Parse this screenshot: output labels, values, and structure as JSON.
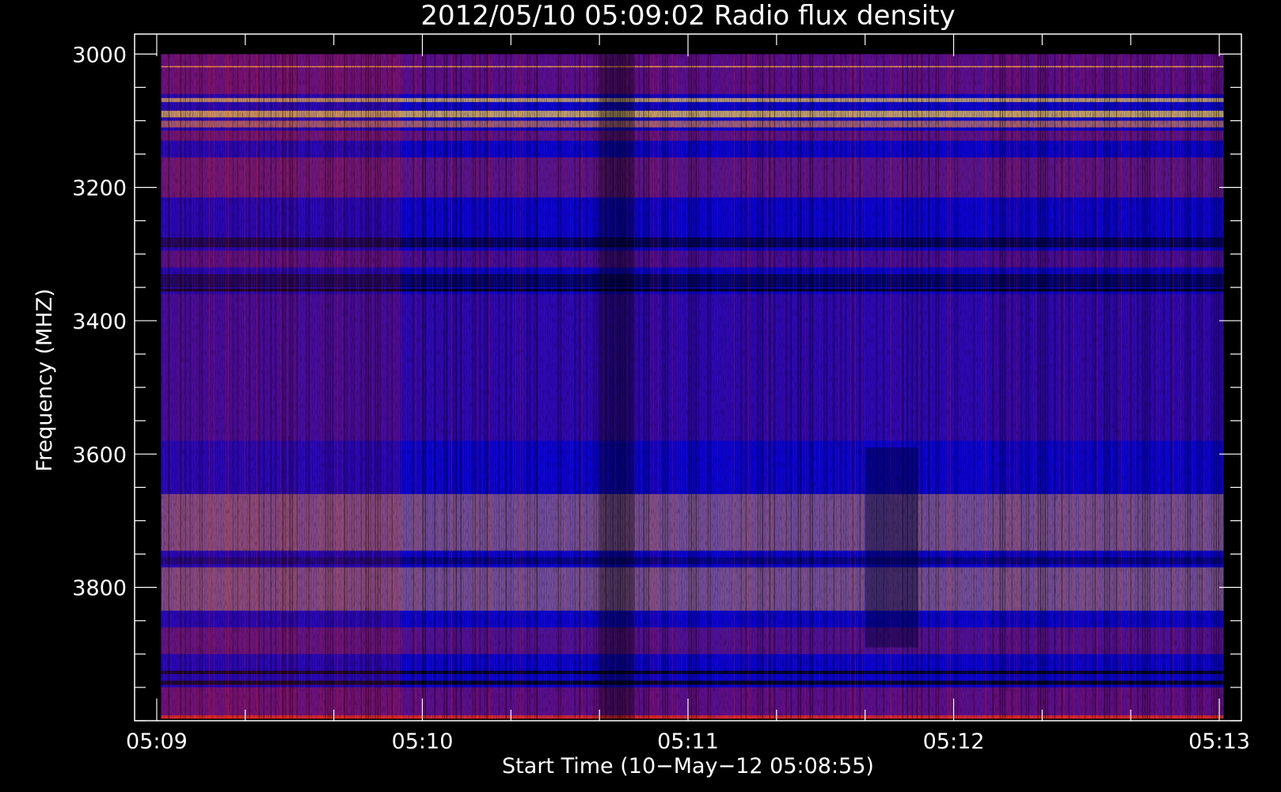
{
  "chart_data": {
    "type": "heatmap",
    "title": "2012/05/10 05:09:02 Radio flux density",
    "xlabel": "Start Time (10−May−12 05:08:55)",
    "ylabel": "Frequency (MHZ)",
    "x_ticks": [
      "05:09",
      "05:10",
      "05:11",
      "05:12",
      "05:13"
    ],
    "y_ticks": [
      "3000",
      "3200",
      "3400",
      "3600",
      "3800"
    ],
    "x_range": [
      "05:08:55",
      "05:13:05"
    ],
    "y_range": [
      2970,
      4000
    ],
    "y_inverted": true,
    "data_x_range": [
      "05:09:01",
      "05:13:01"
    ],
    "data_y_range": [
      3000,
      3997
    ],
    "colormap": [
      "#000000",
      "#0000ff",
      "#ff2a00",
      "#ffd84a"
    ],
    "background": "#0a00c8",
    "grid": false,
    "frame_color": "#ffffff",
    "bands": [
      {
        "f0": 3000,
        "f1": 3060,
        "color": "#c81c28",
        "opacity": 0.45
      },
      {
        "f0": 3018,
        "f1": 3020,
        "color": "#ffb040",
        "opacity": 0.85
      },
      {
        "f0": 3066,
        "f1": 3072,
        "color": "#ffd84a",
        "opacity": 0.7
      },
      {
        "f0": 3085,
        "f1": 3095,
        "color": "#ffd84a",
        "opacity": 0.75
      },
      {
        "f0": 3100,
        "f1": 3110,
        "color": "#ffa040",
        "opacity": 0.6
      },
      {
        "f0": 3115,
        "f1": 3130,
        "color": "#e02a10",
        "opacity": 0.4
      },
      {
        "f0": 3155,
        "f1": 3215,
        "color": "#e03010",
        "opacity": 0.4
      },
      {
        "f0": 3275,
        "f1": 3290,
        "color": "#000000",
        "opacity": 0.55
      },
      {
        "f0": 3295,
        "f1": 3320,
        "color": "#c02020",
        "opacity": 0.35
      },
      {
        "f0": 3330,
        "f1": 3350,
        "color": "#000000",
        "opacity": 0.5
      },
      {
        "f0": 3352,
        "f1": 3356,
        "color": "#000000",
        "opacity": 0.85
      },
      {
        "f0": 3360,
        "f1": 3580,
        "color": "#d02010",
        "opacity": 0.18
      },
      {
        "f0": 3660,
        "f1": 3745,
        "color": "#ffb040",
        "opacity": 0.45
      },
      {
        "f0": 3755,
        "f1": 3765,
        "color": "#000040",
        "opacity": 0.5
      },
      {
        "f0": 3770,
        "f1": 3835,
        "color": "#ffb040",
        "opacity": 0.45
      },
      {
        "f0": 3860,
        "f1": 3900,
        "color": "#e02a10",
        "opacity": 0.35
      },
      {
        "f0": 3925,
        "f1": 3930,
        "color": "#000000",
        "opacity": 0.8
      },
      {
        "f0": 3940,
        "f1": 3946,
        "color": "#000000",
        "opacity": 0.8
      },
      {
        "f0": 3950,
        "f1": 3997,
        "color": "#e02010",
        "opacity": 0.4
      },
      {
        "f0": 3992,
        "f1": 3997,
        "color": "#ff3010",
        "opacity": 0.8
      }
    ]
  }
}
